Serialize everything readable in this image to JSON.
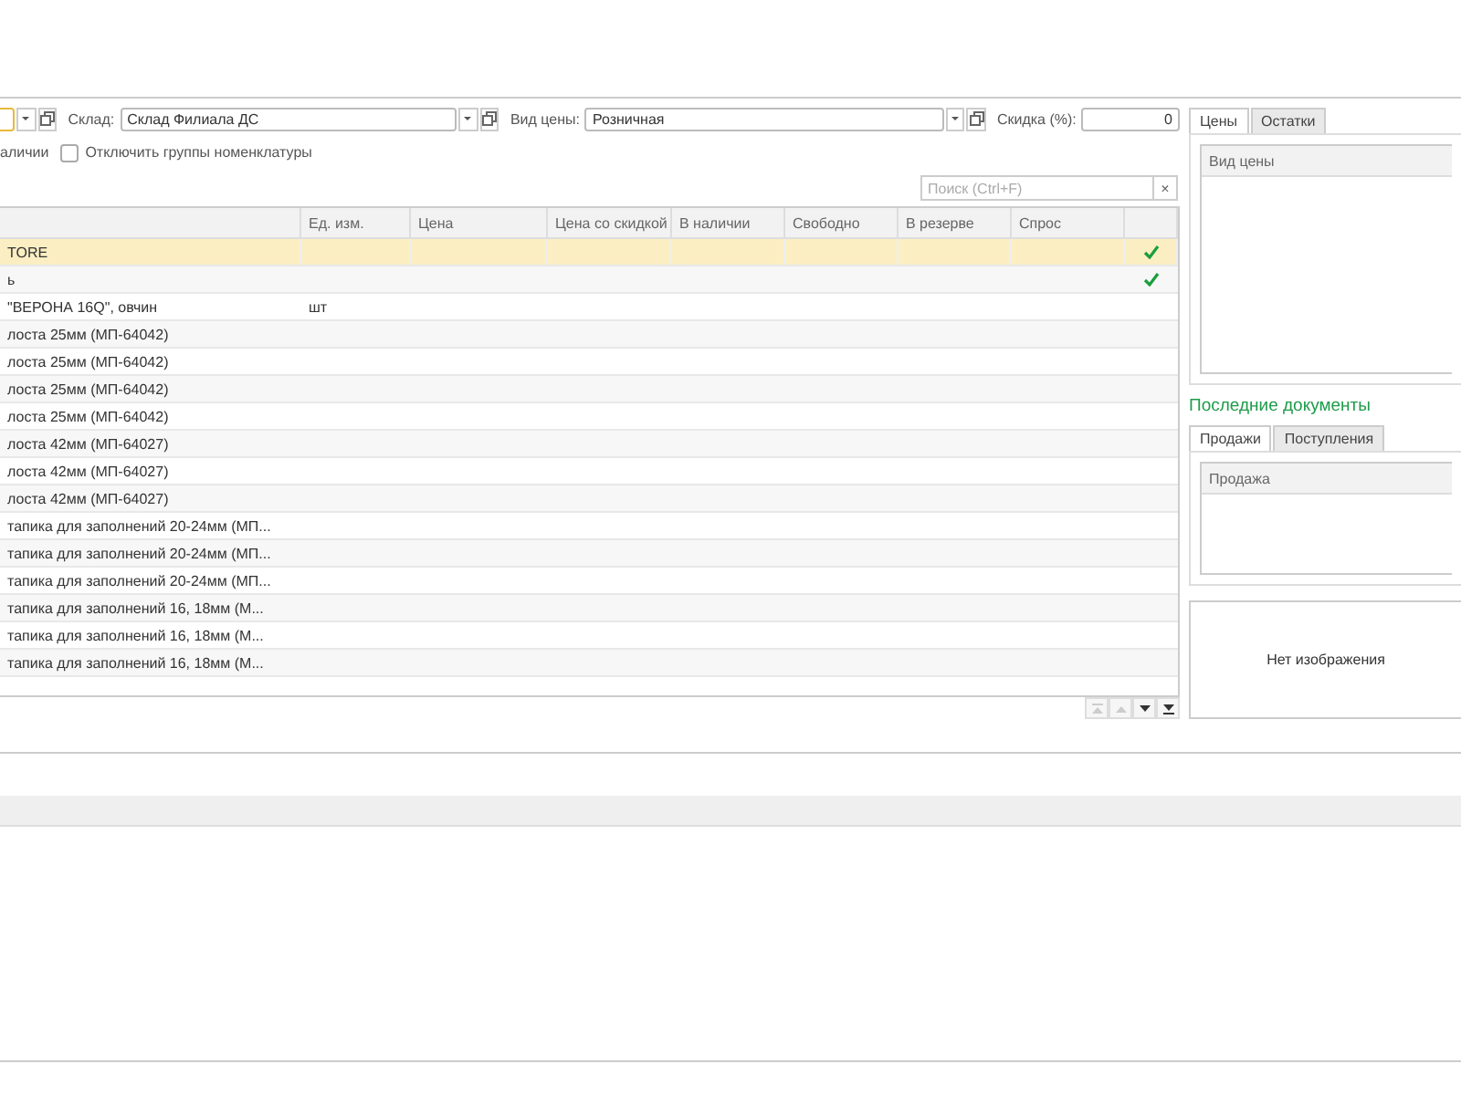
{
  "filters": [
    {
      "kind": "select",
      "focused": true
    },
    {
      "kind": "select",
      "label": "Склад:",
      "value": "Склад Филиала ДС",
      "focused": false
    },
    {
      "kind": "select",
      "label": "Вид цены:",
      "value": "Розничная",
      "focused": false
    },
    {
      "kind": "number",
      "label": "Скидка (%):",
      "value": "0",
      "focused": false
    }
  ],
  "options": [
    {
      "label": "аличии"
    },
    {
      "label": "Отключить группы номенклатуры",
      "checked": false
    }
  ],
  "search": {
    "placeholder": "Поиск (Ctrl+F)",
    "clear": "×"
  },
  "table": {
    "columns": [
      "",
      "Ед. изм.",
      "Цена",
      "Цена со скидкой",
      "В наличии",
      "Свободно",
      "В резерве",
      "Спрос",
      ""
    ],
    "rows": [
      {
        "name": "TORE",
        "selected": true,
        "checked": true
      },
      {
        "name": "ь",
        "selected": false,
        "checked": true
      },
      {
        "name": "\"ВЕРОНА 16Q\", овчин",
        "unit": "шт",
        "selected": false,
        "checked": false
      },
      {
        "name": "лоста 25мм (МП-64042)",
        "selected": false,
        "checked": false
      },
      {
        "name": "лоста 25мм (МП-64042)",
        "selected": false,
        "checked": false
      },
      {
        "name": "лоста 25мм (МП-64042)",
        "selected": false,
        "checked": false
      },
      {
        "name": "лоста 25мм (МП-64042)",
        "selected": false,
        "checked": false
      },
      {
        "name": "лоста 42мм (МП-64027)",
        "selected": false,
        "checked": false
      },
      {
        "name": "лоста 42мм (МП-64027)",
        "selected": false,
        "checked": false
      },
      {
        "name": "лоста 42мм (МП-64027)",
        "selected": false,
        "checked": false
      },
      {
        "name": "тапика для заполнений 20-24мм (МП...",
        "selected": false,
        "checked": false
      },
      {
        "name": "тапика для заполнений 20-24мм (МП...",
        "selected": false,
        "checked": false
      },
      {
        "name": "тапика для заполнений 20-24мм (МП...",
        "selected": false,
        "checked": false
      },
      {
        "name": "тапика для заполнений 16, 18мм (М...",
        "selected": false,
        "checked": false
      },
      {
        "name": "тапика для заполнений 16, 18мм (М...",
        "selected": false,
        "checked": false
      },
      {
        "name": "тапика для заполнений 16, 18мм (М...",
        "selected": false,
        "checked": false
      }
    ],
    "nav": [
      {
        "kind": "first",
        "disabled": true
      },
      {
        "kind": "up",
        "disabled": true
      },
      {
        "kind": "down",
        "disabled": false
      },
      {
        "kind": "last",
        "disabled": false
      }
    ]
  },
  "side": {
    "tabs": [
      {
        "label": "Цены",
        "selected": true
      },
      {
        "label": "Остатки",
        "selected": false
      }
    ],
    "prices_table": {
      "columns": [
        "Вид цены"
      ]
    },
    "recent_title": "Последние документы",
    "doc_tabs": [
      {
        "label": "Продажи",
        "selected": true
      },
      {
        "label": "Поступления",
        "selected": false
      }
    ],
    "docs_table": {
      "columns": [
        "Продажа"
      ]
    },
    "image_placeholder": "Нет изображения"
  }
}
